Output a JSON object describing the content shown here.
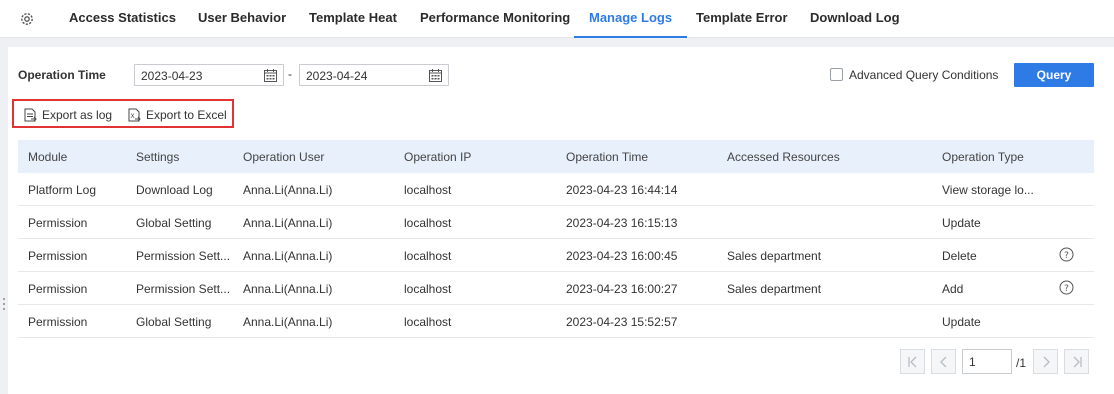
{
  "tabs": [
    {
      "label": "Access Statistics",
      "active": false
    },
    {
      "label": "User Behavior",
      "active": false
    },
    {
      "label": "Template Heat",
      "active": false
    },
    {
      "label": "Performance Monitoring",
      "active": false
    },
    {
      "label": "Manage Logs",
      "active": true
    },
    {
      "label": "Template Error",
      "active": false
    },
    {
      "label": "Download Log",
      "active": false
    }
  ],
  "filters": {
    "operation_time_label": "Operation Time",
    "start_date": "2023-04-23",
    "separator": "-",
    "end_date": "2023-04-24",
    "advanced_label": "Advanced Query Conditions",
    "advanced_checked": false,
    "query_label": "Query"
  },
  "export": {
    "as_log_label": "Export as log",
    "to_excel_label": "Export to Excel"
  },
  "table": {
    "columns": [
      "Module",
      "Settings",
      "Operation User",
      "Operation IP",
      "Operation Time",
      "Accessed Resources",
      "Operation Type"
    ],
    "rows": [
      {
        "module": "Platform Log",
        "settings": "Download Log",
        "user": "Anna.Li(Anna.Li)",
        "ip": "localhost",
        "time": "2023-04-23 16:44:14",
        "resources": "",
        "type": "View storage lo...",
        "help": false
      },
      {
        "module": "Permission",
        "settings": "Global Setting",
        "user": "Anna.Li(Anna.Li)",
        "ip": "localhost",
        "time": "2023-04-23 16:15:13",
        "resources": "",
        "type": "Update",
        "help": false
      },
      {
        "module": "Permission",
        "settings": "Permission Sett...",
        "user": "Anna.Li(Anna.Li)",
        "ip": "localhost",
        "time": "2023-04-23 16:00:45",
        "resources": "Sales department",
        "type": "Delete",
        "help": true
      },
      {
        "module": "Permission",
        "settings": "Permission Sett...",
        "user": "Anna.Li(Anna.Li)",
        "ip": "localhost",
        "time": "2023-04-23 16:00:27",
        "resources": "Sales department",
        "type": "Add",
        "help": true
      },
      {
        "module": "Permission",
        "settings": "Global Setting",
        "user": "Anna.Li(Anna.Li)",
        "ip": "localhost",
        "time": "2023-04-23 15:52:57",
        "resources": "",
        "type": "Update",
        "help": false
      }
    ]
  },
  "pagination": {
    "current_page": "1",
    "total_label": "/1"
  },
  "colors": {
    "accent": "#2f7be6",
    "highlight_border": "#e23232",
    "header_bg": "#e8f0fb"
  },
  "icons": {
    "settings": "gear-icon",
    "calendar": "calendar-icon",
    "export_log": "export-log-icon",
    "export_excel": "export-excel-icon",
    "help": "help-circle-icon"
  }
}
